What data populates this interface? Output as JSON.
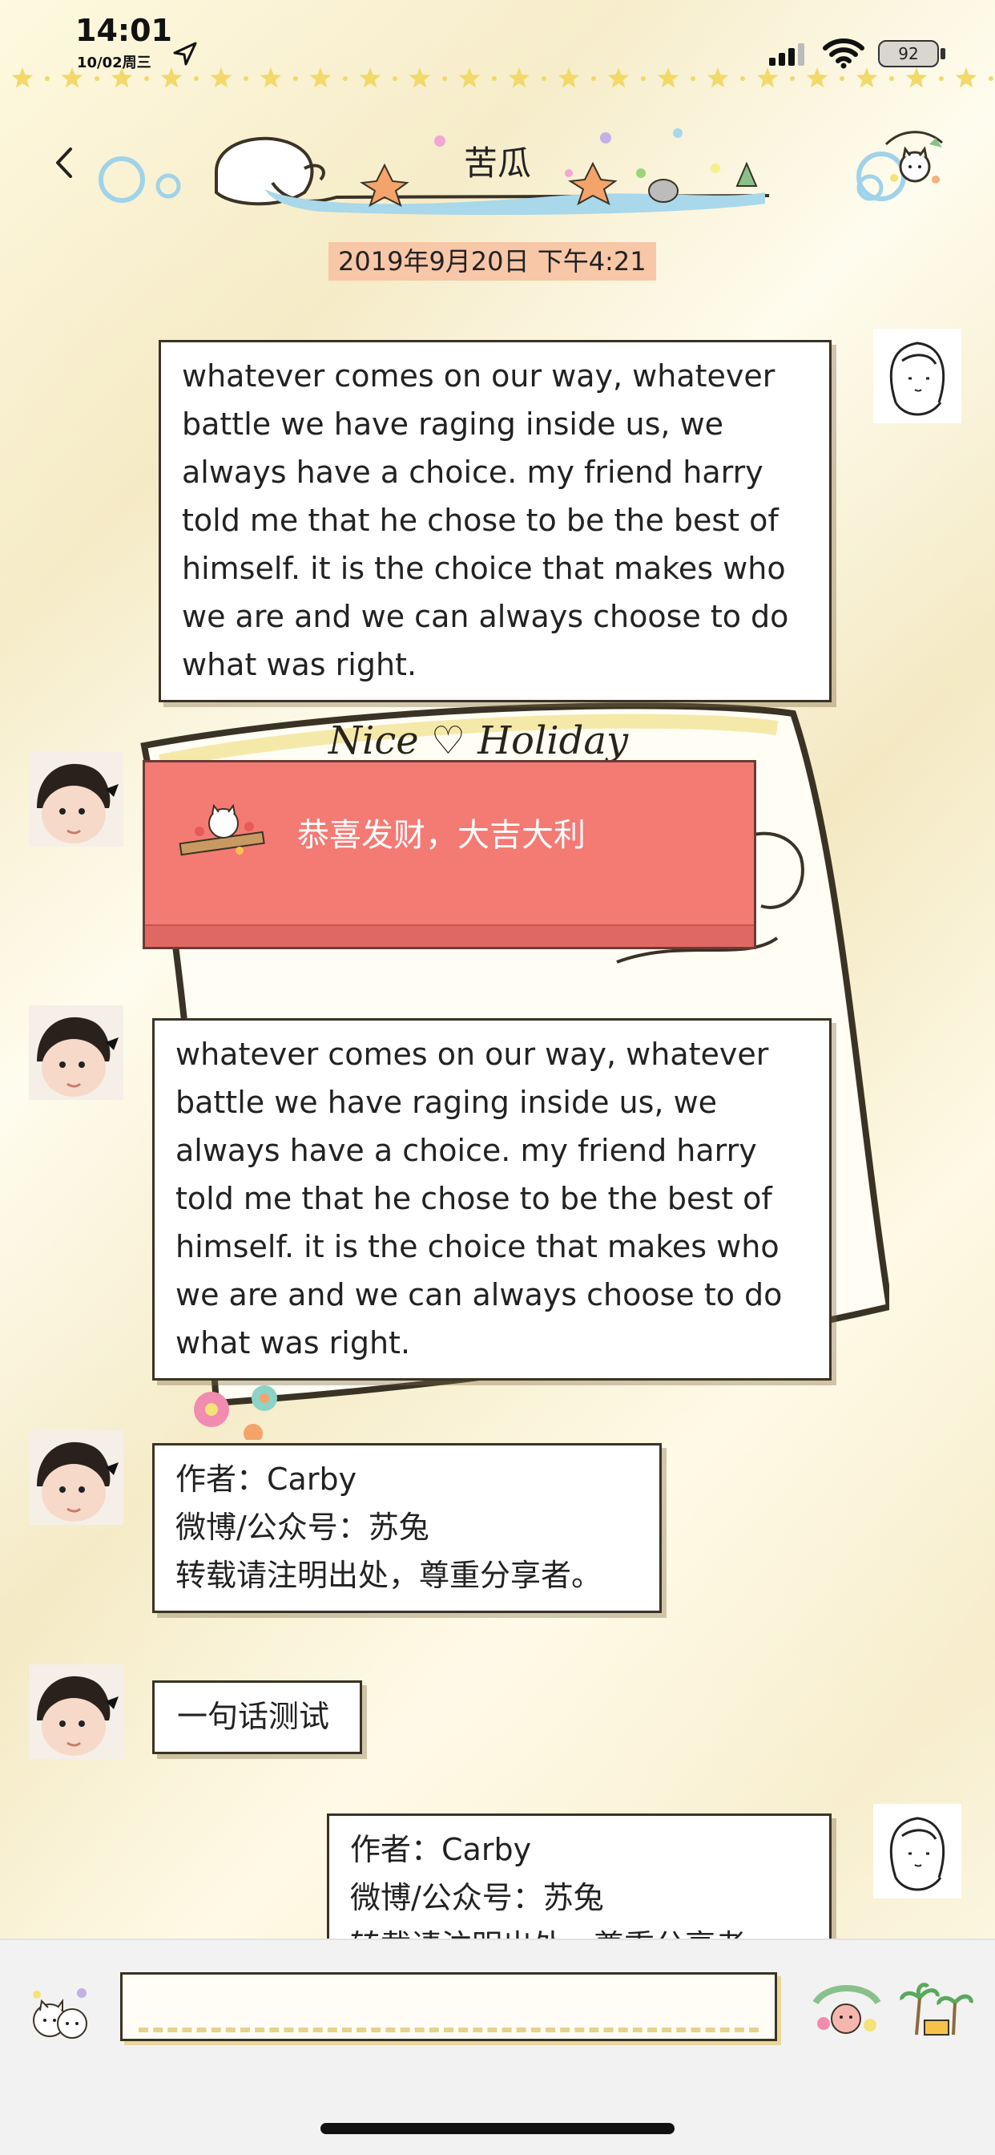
{
  "status_bar": {
    "time": "14:01",
    "date": "10/02周三",
    "battery": "92"
  },
  "nav": {
    "title": "苦瓜"
  },
  "timestamp": "2019年9月20日 下午4:21",
  "messages": [
    {
      "side": "right",
      "avatar": "girl-avatar",
      "text": "whatever comes on our way, whatever battle we have raging inside us, we always have a choice. my friend harry told me that he chose to be the best of himself. it is the choice that makes who we are and we can always choose to do what was right."
    },
    {
      "side": "left",
      "avatar": "baby-avatar",
      "type": "red-packet",
      "text": "恭喜发财，大吉大利"
    },
    {
      "side": "left",
      "avatar": "baby-avatar",
      "text": "whatever comes on our way, whatever battle we have raging inside us, we always have a choice. my friend harry told me that he chose to be the best of himself. it is the choice that makes who we are and we can always choose to do what was right."
    },
    {
      "side": "left",
      "avatar": "baby-avatar",
      "lines": [
        "作者：Carby",
        "微博/公众号：苏兔",
        "转载请注明出处，尊重分享者。"
      ]
    },
    {
      "side": "left",
      "avatar": "baby-avatar",
      "text": "一句话测试"
    },
    {
      "side": "right",
      "avatar": "girl-avatar",
      "lines": [
        "作者：Carby",
        "微博/公众号：苏兔",
        "转载请注明出处，尊重分享者。"
      ]
    }
  ],
  "sticker_note_text": "Nice ♡ Holiday",
  "input": {
    "value": ""
  },
  "colors": {
    "background": "#fbf4dd",
    "timestamp_bg": "#f7c7a8",
    "red_packet": "#f47a74",
    "bubble_border": "#3a3325"
  }
}
